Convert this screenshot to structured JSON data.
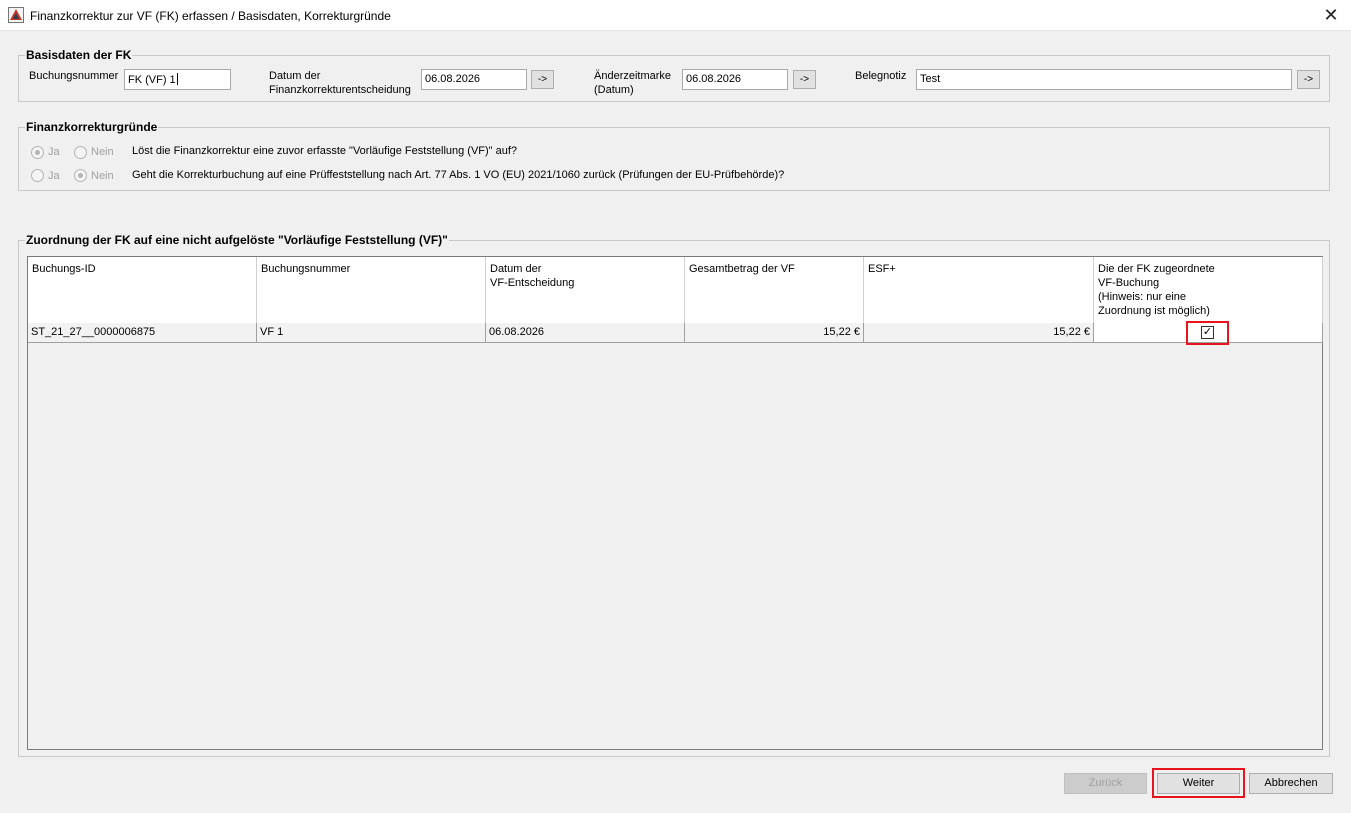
{
  "window": {
    "title": "Finanzkorrektur zur VF (FK) erfassen / Basisdaten, Korrekturgründe",
    "close_glyph": "✕",
    "app_icon": "app-icon"
  },
  "basisdaten": {
    "title": "Basisdaten der FK",
    "buchungsnummer_label": "Buchungsnummer",
    "buchungsnummer_value": "FK (VF) 1",
    "datum_label_1": "Datum der",
    "datum_label_2": "Finanzkorrekturentscheidung",
    "datum_value": "06.08.2026",
    "aenderung_label_1": "Änderzeitmarke",
    "aenderung_label_2": "(Datum)",
    "aenderung_value": "06.08.2026",
    "belegnotiz_label": "Belegnotiz",
    "belegnotiz_value": "Test",
    "arrow_label": "->"
  },
  "gruende": {
    "title": "Finanzkorrekturgründe",
    "ja_label": "Ja",
    "nein_label": "Nein",
    "q1": "Löst die Finanzkorrektur eine zuvor erfasste \"Vorläufige Feststellung (VF)\" auf?",
    "q1_selected": "Ja",
    "q2": "Geht die Korrekturbuchung auf eine Prüffeststellung nach Art. 77 Abs. 1 VO (EU) 2021/1060 zurück (Prüfungen der EU-Prüfbehörde)?",
    "q2_selected": "Nein"
  },
  "zuordnung": {
    "title": "Zuordnung der FK auf eine nicht aufgelöste \"Vorläufige Feststellung (VF)\"",
    "columns": {
      "c1": "Buchungs-ID",
      "c2": "Buchungsnummer",
      "c3_1": "Datum der",
      "c3_2": "VF-Entscheidung",
      "c4": "Gesamtbetrag der VF",
      "c5": "ESF+",
      "c6_1": "Die der FK zugeordnete",
      "c6_2": "VF-Buchung",
      "c6_3": "(Hinweis: nur eine",
      "c6_4": "Zuordnung ist möglich)"
    },
    "rows": [
      {
        "buchungs_id": "ST_21_27__0000006875",
        "buchungsnummer": "VF 1",
        "datum": "06.08.2026",
        "gesamtbetrag": "15,22 €",
        "esf": "15,22 €",
        "zugeordnet": true,
        "check_glyph": "✓"
      }
    ]
  },
  "buttons": {
    "zurueck": "Zurück",
    "weiter": "Weiter",
    "abbrechen": "Abbrechen"
  },
  "colors": {
    "highlight": "#e8141c"
  }
}
